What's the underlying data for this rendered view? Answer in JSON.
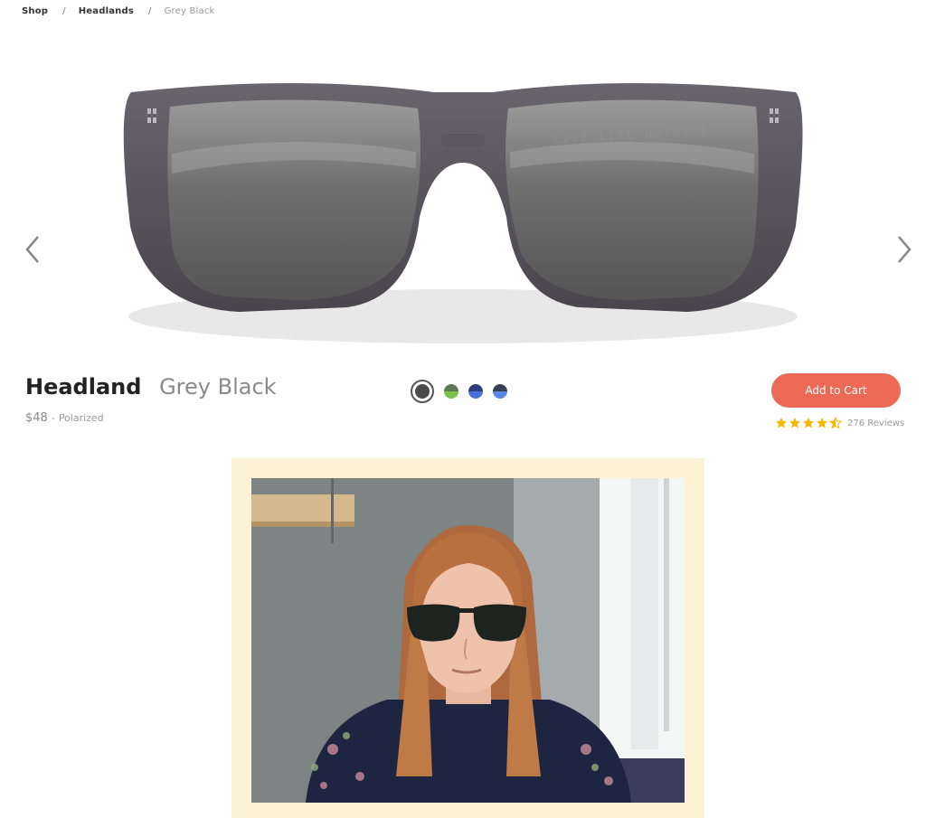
{
  "breadcrumb": {
    "items": [
      "Shop",
      "Headlands",
      "Grey Black"
    ],
    "separator": "/"
  },
  "product": {
    "name": "Headland",
    "color_name": "Grey Black",
    "price": "$48",
    "separator": "-",
    "lens_type": "Polarized",
    "hero_image_alt": "LIVE LIFE OUTSIDE"
  },
  "swatches": [
    {
      "name": "grey-black",
      "selected": true
    },
    {
      "name": "green",
      "selected": false
    },
    {
      "name": "blue",
      "selected": false
    },
    {
      "name": "blue-grey",
      "selected": false
    }
  ],
  "cart": {
    "button_label": "Add to Cart",
    "rating_value": 4.5,
    "rating_max": 5,
    "reviews_label": "276 Reviews"
  },
  "icons": {
    "prev": "chevron-left-icon",
    "next": "chevron-right-icon",
    "star": "star-icon"
  },
  "colors": {
    "accent": "#ec6a55",
    "star": "#f5b800",
    "frame_background": "#fdf2d4"
  }
}
